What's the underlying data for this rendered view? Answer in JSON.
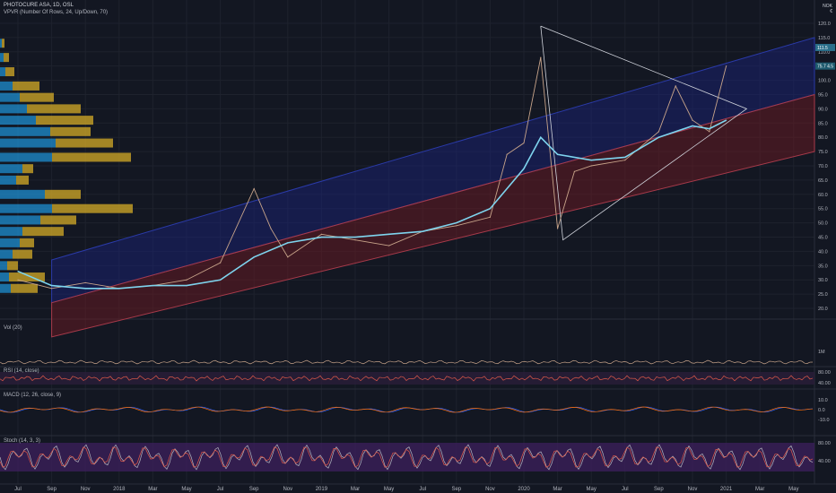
{
  "header": {
    "title": "PHOTOCURE ASA, 1D, OSL",
    "vpvr": "VPVR (Number Of Rows, 24, Up/Down, 70)",
    "currency": "NOK",
    "currency2": "€"
  },
  "panes": {
    "vol_label": "Vol (20)",
    "rsi_label": "RSI (14, close)",
    "macd_label": "MACD (12, 26, close, 9)",
    "stoch_label": "Stoch (14, 3, 3)"
  },
  "price_tags": {
    "last": "111.5",
    "last2": "75.7 4.5"
  },
  "colors": {
    "bg": "#131722",
    "grid": "#1e222d",
    "price": "#c8a48a",
    "sma": "#7ed4ee",
    "blue_channel": "#1a237e",
    "red_channel": "#6b1a22",
    "vp_blue": "#1f8fd0",
    "vp_gold": "#c9a227",
    "stoch_band": "#3b1f5a"
  },
  "chart_data": {
    "type": "line",
    "title": "PHOTOCURE ASA, 1D, OSL",
    "x_ticks": [
      "Jul",
      "Sep",
      "Nov",
      "2018",
      "Mar",
      "May",
      "Jul",
      "Sep",
      "Nov",
      "2019",
      "Mar",
      "May",
      "Jul",
      "Sep",
      "Nov",
      "2020",
      "Mar",
      "May",
      "Jul",
      "Sep",
      "Nov",
      "2021",
      "Mar",
      "May"
    ],
    "y_ticks": [
      "120.0",
      "115.0",
      "110.0",
      "105.0",
      "100.0",
      "95.0",
      "90.0",
      "85.0",
      "80.0",
      "75.0",
      "70.0",
      "65.0",
      "60.0",
      "55.0",
      "50.0",
      "45.0",
      "40.0",
      "35.0",
      "30.0",
      "25.0",
      "20.0"
    ],
    "ylim": [
      17.5,
      122.5
    ],
    "series": [
      {
        "x": [
          "Jul 2017",
          "Sep 2017",
          "Nov 2017",
          "Jan 2018",
          "Mar 2018",
          "May 2018",
          "Jul 2018",
          "Sep 2018",
          "Oct 2018",
          "Nov 2018",
          "Jan 2019",
          "Mar 2019",
          "May 2019",
          "Jul 2019",
          "Sep 2019",
          "Nov 2019",
          "Dec 2019",
          "Jan 2020",
          "Feb 2020",
          "Mar 2020",
          "Apr 2020",
          "May 2020",
          "Jul 2020",
          "Sep 2020",
          "Oct 2020",
          "Nov 2020",
          "Dec 2020",
          "Jan 2021"
        ],
        "values": [
          30,
          27,
          29,
          27,
          28,
          30,
          36,
          62,
          48,
          38,
          46,
          44,
          42,
          47,
          49,
          52,
          74,
          78,
          108,
          48,
          68,
          70,
          72,
          82,
          98,
          86,
          82,
          105
        ]
      },
      {
        "x": [
          "Jul 2017",
          "Sep 2017",
          "Nov 2017",
          "Jan 2018",
          "Mar 2018",
          "May 2018",
          "Jul 2018",
          "Sep 2018",
          "Nov 2018",
          "Jan 2019",
          "Mar 2019",
          "May 2019",
          "Jul 2019",
          "Sep 2019",
          "Nov 2019",
          "Jan 2020",
          "Feb 2020",
          "Mar 2020",
          "May 2020",
          "Jul 2020",
          "Sep 2020",
          "Nov 2020",
          "Dec 2020",
          "Jan 2021"
        ],
        "values": [
          33,
          28,
          27,
          27,
          28,
          28,
          30,
          38,
          43,
          45,
          45,
          46,
          47,
          50,
          55,
          69,
          80,
          74,
          72,
          73,
          80,
          84,
          83,
          86
        ]
      }
    ],
    "sub_panes": [
      {
        "name": "Vol (20)",
        "ticks": [
          "1M"
        ]
      },
      {
        "name": "RSI (14, close)",
        "ticks": [
          "80.00",
          "40.00"
        ]
      },
      {
        "name": "MACD (12, 26, close, 9)",
        "ticks": [
          "10.0",
          "0.0",
          "-10.0"
        ]
      },
      {
        "name": "Stoch (14, 3, 3)",
        "ticks": [
          "80.00",
          "40.00"
        ]
      }
    ]
  }
}
